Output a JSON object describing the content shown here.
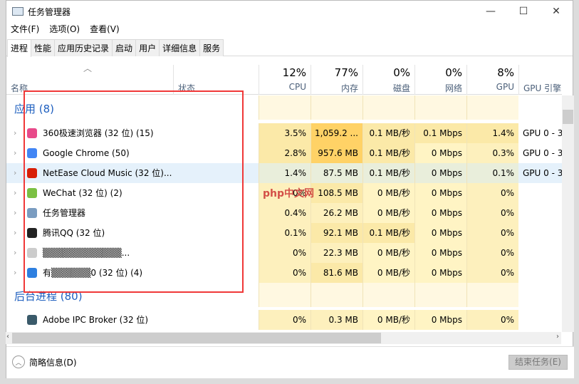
{
  "window": {
    "title": "任务管理器",
    "minimize": "—",
    "maximize": "☐",
    "close": "✕"
  },
  "menu": [
    "文件(F)",
    "选项(O)",
    "查看(V)"
  ],
  "tabs": [
    "进程",
    "性能",
    "应用历史记录",
    "启动",
    "用户",
    "详细信息",
    "服务"
  ],
  "columns": {
    "name": "名称",
    "status": "状态",
    "cpu": {
      "pct": "12%",
      "label": "CPU"
    },
    "mem": {
      "pct": "77%",
      "label": "内存"
    },
    "disk": {
      "pct": "0%",
      "label": "磁盘"
    },
    "net": {
      "pct": "0%",
      "label": "网络"
    },
    "gpu": {
      "pct": "8%",
      "label": "GPU"
    },
    "gpueng": {
      "label": "GPU 引擎"
    }
  },
  "groups": {
    "apps": "应用 (8)",
    "background": "后台进程 (80)"
  },
  "apps": [
    {
      "name": "360极速浏览器 (32 位) (15)",
      "icon": "360-browser-icon",
      "color": "#e84a8a",
      "cpu": "3.5%",
      "mem": "1,059.2 ...",
      "disk": "0.1 MB/秒",
      "net": "0.1 Mbps",
      "gpu": "1.4%",
      "eng": "GPU 0 - 3"
    },
    {
      "name": "Google Chrome (50)",
      "icon": "chrome-icon",
      "color": "#4285f4",
      "cpu": "2.8%",
      "mem": "957.6 MB",
      "disk": "0.1 MB/秒",
      "net": "0 Mbps",
      "gpu": "0.3%",
      "eng": "GPU 0 - 3"
    },
    {
      "name": "NetEase Cloud Music (32 位)...",
      "icon": "netease-music-icon",
      "color": "#d81e06",
      "cpu": "1.4%",
      "mem": "87.5 MB",
      "disk": "0.1 MB/秒",
      "net": "0 Mbps",
      "gpu": "0.1%",
      "eng": "GPU 0 - 3"
    },
    {
      "name": "WeChat (32 位) (2)",
      "icon": "wechat-icon",
      "color": "#7bc043",
      "cpu": "0%",
      "mem": "108.5 MB",
      "disk": "0 MB/秒",
      "net": "0 Mbps",
      "gpu": "0%",
      "eng": ""
    },
    {
      "name": "任务管理器",
      "icon": "task-manager-icon",
      "color": "#7a9cc0",
      "cpu": "0.4%",
      "mem": "26.2 MB",
      "disk": "0 MB/秒",
      "net": "0 Mbps",
      "gpu": "0%",
      "eng": ""
    },
    {
      "name": "腾讯QQ (32 位)",
      "icon": "qq-icon",
      "color": "#222",
      "cpu": "0.1%",
      "mem": "92.1 MB",
      "disk": "0.1 MB/秒",
      "net": "0 Mbps",
      "gpu": "0%",
      "eng": ""
    },
    {
      "name": "▒▒▒▒▒▒▒▒▒▒▒▒...",
      "icon": "blurred-app-icon",
      "color": "#ccc",
      "cpu": "0%",
      "mem": "22.3 MB",
      "disk": "0 MB/秒",
      "net": "0 Mbps",
      "gpu": "0%",
      "eng": ""
    },
    {
      "name": "有▒▒▒▒▒▒0 (32 位) (4)",
      "icon": "blue-app-icon",
      "color": "#2d7fe0",
      "cpu": "0%",
      "mem": "81.6 MB",
      "disk": "0 MB/秒",
      "net": "0 Mbps",
      "gpu": "0%",
      "eng": ""
    }
  ],
  "background": [
    {
      "name": "Adobe IPC Broker (32 位)",
      "icon": "adobe-ipc-icon",
      "color": "#3a5a6a",
      "cpu": "0%",
      "mem": "0.3 MB",
      "disk": "0 MB/秒",
      "net": "0 Mbps",
      "gpu": "0%",
      "eng": ""
    }
  ],
  "footer": {
    "fewer_details": "简略信息(D)",
    "end_task": "结束任务(E)"
  },
  "watermark": "php中文网"
}
